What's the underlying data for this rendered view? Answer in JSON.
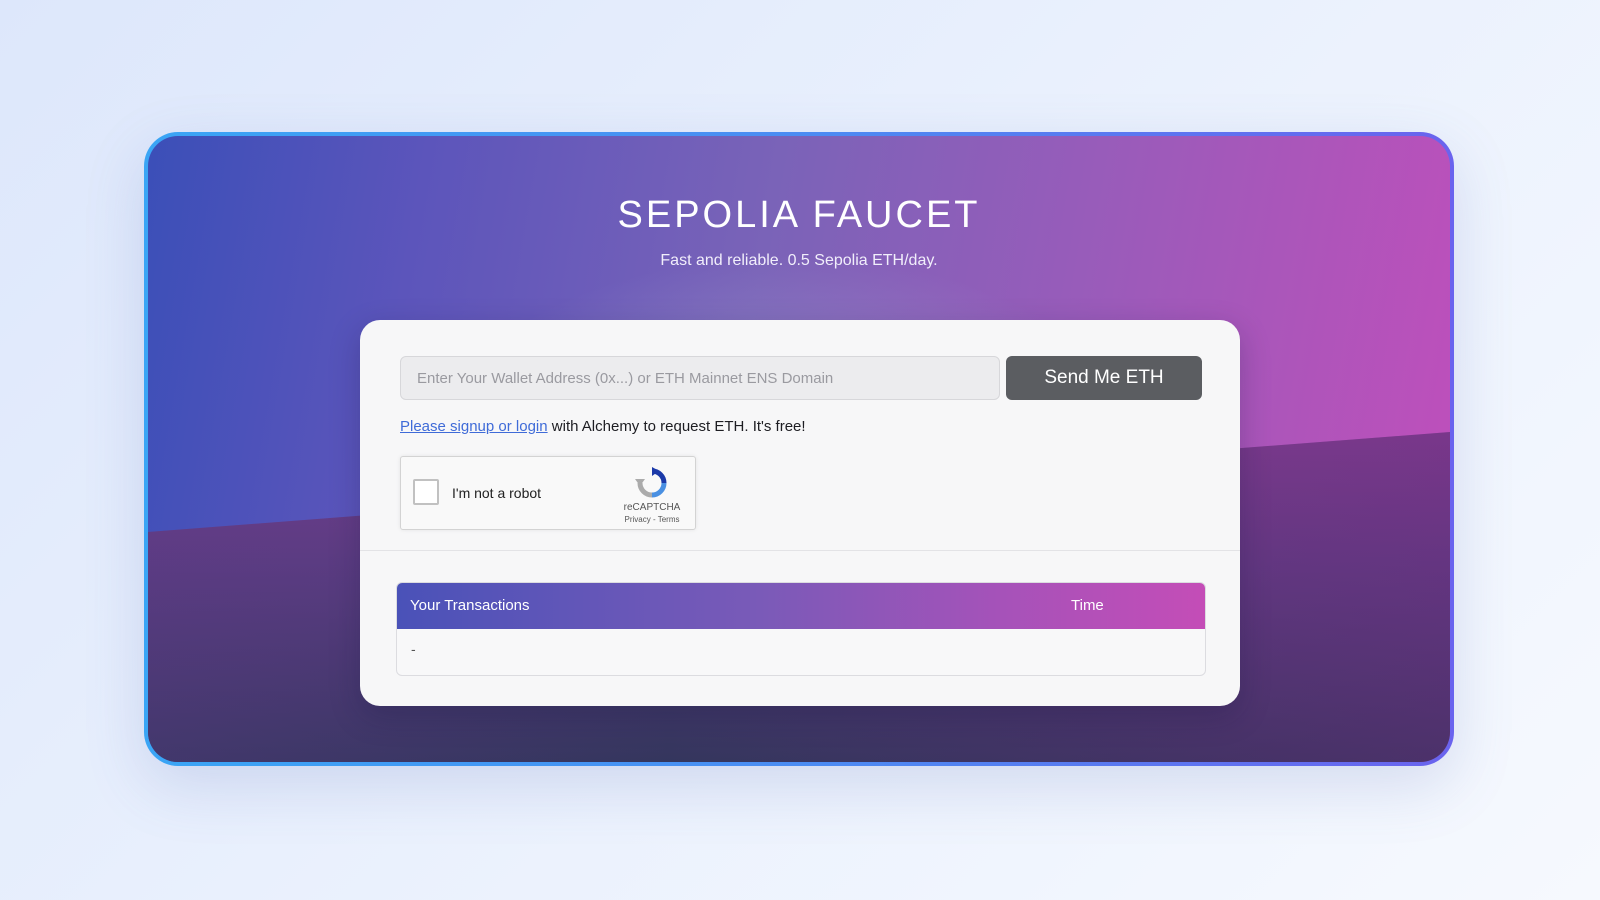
{
  "header": {
    "title": "SEPOLIA FAUCET",
    "subtitle": "Fast and reliable. 0.5 Sepolia ETH/day."
  },
  "form": {
    "wallet_placeholder": "Enter Your Wallet Address (0x...) or ETH Mainnet ENS Domain",
    "wallet_value": "",
    "send_label": "Send Me ETH",
    "signup_link": "Please signup or login",
    "signup_rest": " with Alchemy to request ETH. It's free!"
  },
  "captcha": {
    "label": "I'm not a robot",
    "brand": "reCAPTCHA",
    "links": "Privacy - Terms",
    "checked": false
  },
  "transactions": {
    "col_transactions": "Your Transactions",
    "col_time": "Time",
    "rows": [
      {
        "transaction": "-",
        "time": ""
      }
    ]
  },
  "colors": {
    "frame_border": "#3aa5f5",
    "hero_left": "#3b4fb8",
    "hero_right": "#c24ebb",
    "send_button": "#5b5d61",
    "link": "#3f6bd8"
  },
  "icons": {
    "captcha": "recaptcha-icon"
  }
}
